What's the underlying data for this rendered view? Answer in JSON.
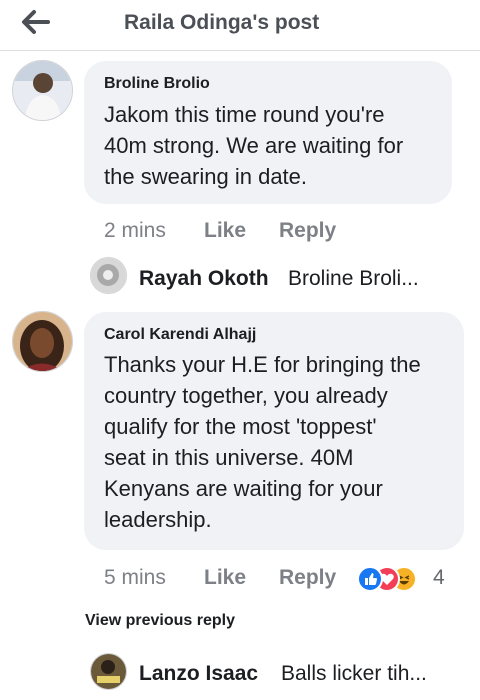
{
  "header": {
    "title": "Raila Odinga's post"
  },
  "comments": [
    {
      "author": "Broline Brolio",
      "text": "Jakom this time round you're\n40m strong. We are waiting for\nthe swearing in date.",
      "time": "2 mins",
      "like": "Like",
      "reply": "Reply",
      "reply_preview": {
        "name": "Rayah Okoth",
        "text": "Broline Broli..."
      }
    },
    {
      "author": "Carol Karendi Alhajj",
      "text": "Thanks your H.E for bringing the\ncountry together, you already\nqualify for the most 'toppest'\nseat in this universe. 40M\nKenyans are waiting for your\nleadership.",
      "time": "5 mins",
      "like": "Like",
      "reply": "Reply",
      "reaction_count": "4",
      "reactions": [
        "like-icon",
        "love-icon",
        "haha-icon"
      ],
      "view_previous": "View previous reply",
      "reply_preview": {
        "name": "Lanzo Isaac",
        "text": "Balls licker tih..."
      }
    }
  ],
  "colors": {
    "like": "#1877f2",
    "love": "#f33e58",
    "haha": "#f7b125",
    "bubble": "#f0f2f5"
  }
}
